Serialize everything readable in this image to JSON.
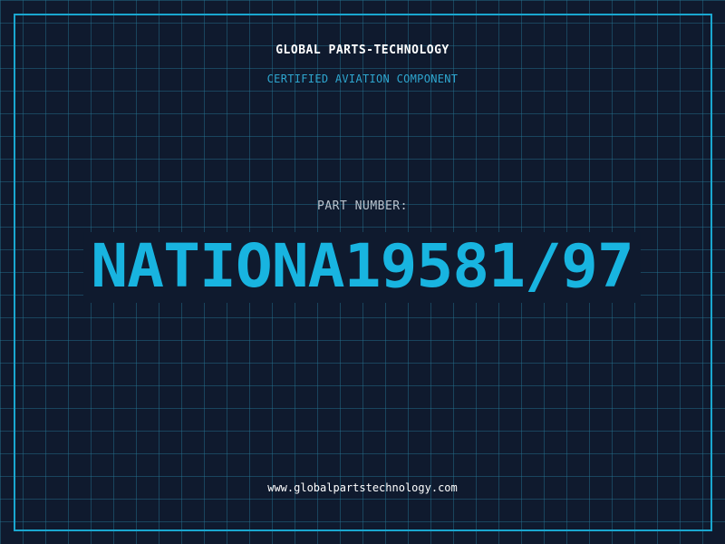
{
  "header": {
    "company": "GLOBAL PARTS-TECHNOLOGY",
    "subtitle": "CERTIFIED AVIATION COMPONENT"
  },
  "part": {
    "label": "PART NUMBER:",
    "number": "NATIONA19581/97"
  },
  "footer": {
    "url": "www.globalpartstechnology.com"
  },
  "colors": {
    "background": "#0f1a2e",
    "grid": "#26789",
    "accent": "#1aa7d0",
    "part_number": "#18b4e0"
  }
}
